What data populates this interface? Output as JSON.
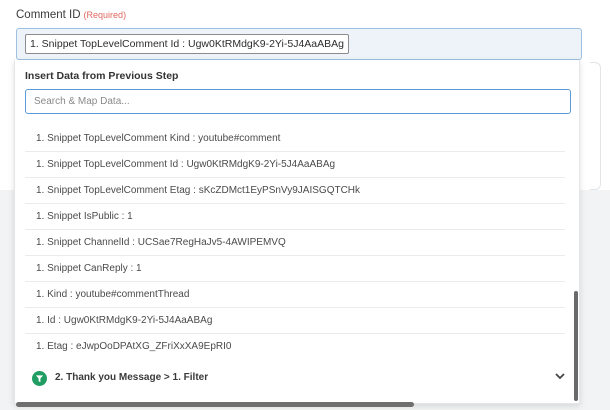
{
  "field": {
    "label": "Comment ID",
    "required": "(Required)",
    "chip": "1. Snippet TopLevelComment Id : Ugw0KtRMdgK9-2Yi-5J4AaABAg"
  },
  "dropdown": {
    "header": "Insert Data from Previous Step",
    "search_placeholder": "Search & Map Data...",
    "search_value": "",
    "items": [
      "1. Snippet TopLevelComment Kind : youtube#comment",
      "1. Snippet TopLevelComment Id : Ugw0KtRMdgK9-2Yi-5J4AaABAg",
      "1. Snippet TopLevelComment Etag : sKcZDMct1EyPSnVy9JAISGQTCHk",
      "1. Snippet IsPublic : 1",
      "1. Snippet ChannelId : UCSae7RegHaJv5-4AWIPEMVQ",
      "1. Snippet CanReply : 1",
      "1. Kind : youtube#commentThread",
      "1. Id : Ugw0KtRMdgK9-2Yi-5J4AaABAg",
      "1. Etag : eJwpOoDPAtXG_ZFriXxXA9EpRI0"
    ],
    "group": {
      "label": "2. Thank you Message > 1. Filter",
      "icon": "filter-icon",
      "expanded": false
    }
  },
  "colors": {
    "accent": "#5b9bd5",
    "required": "#e2685f",
    "group_icon": "#1f9d62",
    "field_bg": "#edf3f8"
  }
}
